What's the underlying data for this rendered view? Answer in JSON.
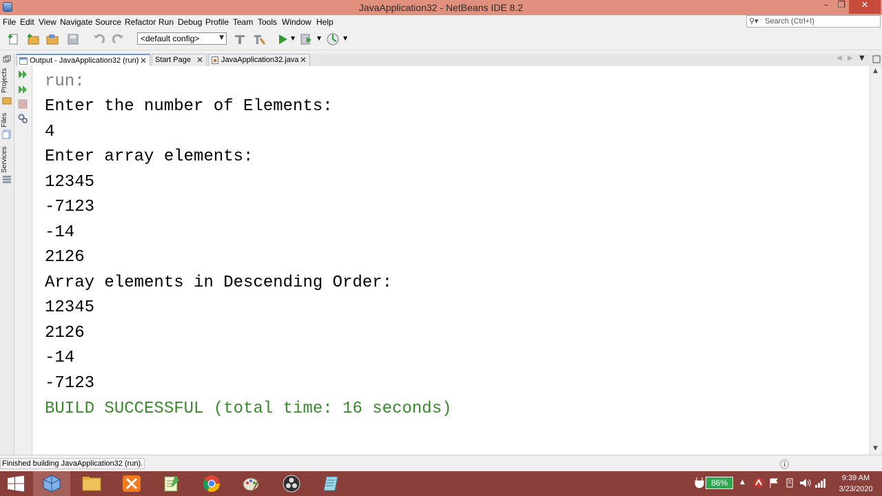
{
  "window": {
    "title": "JavaApplication32 - NetBeans IDE 8.2"
  },
  "menu": [
    "File",
    "Edit",
    "View",
    "Navigate",
    "Source",
    "Refactor",
    "Run",
    "Debug",
    "Profile",
    "Team",
    "Tools",
    "Window",
    "Help"
  ],
  "search": {
    "placeholder": "Search (Ctrl+I)"
  },
  "toolbar": {
    "config": "<default config>"
  },
  "side_panels": [
    "Projects",
    "Files",
    "Services"
  ],
  "tabs": [
    {
      "label": "Output - JavaApplication32 (run)"
    },
    {
      "label": "Start Page"
    },
    {
      "label": "JavaApplication32.java"
    }
  ],
  "output": {
    "lines": [
      {
        "text": "run:",
        "color": "#808080"
      },
      {
        "text": "Enter the number of Elements:",
        "color": "#000000"
      },
      {
        "text": "4",
        "color": "#000000"
      },
      {
        "text": "Enter array elements:",
        "color": "#000000"
      },
      {
        "text": "12345",
        "color": "#000000"
      },
      {
        "text": "-7123",
        "color": "#000000"
      },
      {
        "text": "-14",
        "color": "#000000"
      },
      {
        "text": "2126",
        "color": "#000000"
      },
      {
        "text": "Array elements in Descending Order:",
        "color": "#000000"
      },
      {
        "text": "12345",
        "color": "#000000"
      },
      {
        "text": "2126",
        "color": "#000000"
      },
      {
        "text": "-14",
        "color": "#000000"
      },
      {
        "text": "-7123",
        "color": "#000000"
      },
      {
        "text": "BUILD SUCCESSFUL (total time: 16 seconds)",
        "color": "#3a8a2e"
      }
    ]
  },
  "status": {
    "message": "Finished building JavaApplication32 (run)."
  },
  "taskbar": {
    "battery": "86%",
    "time": "9:39 AM",
    "date": "3/23/2020"
  }
}
